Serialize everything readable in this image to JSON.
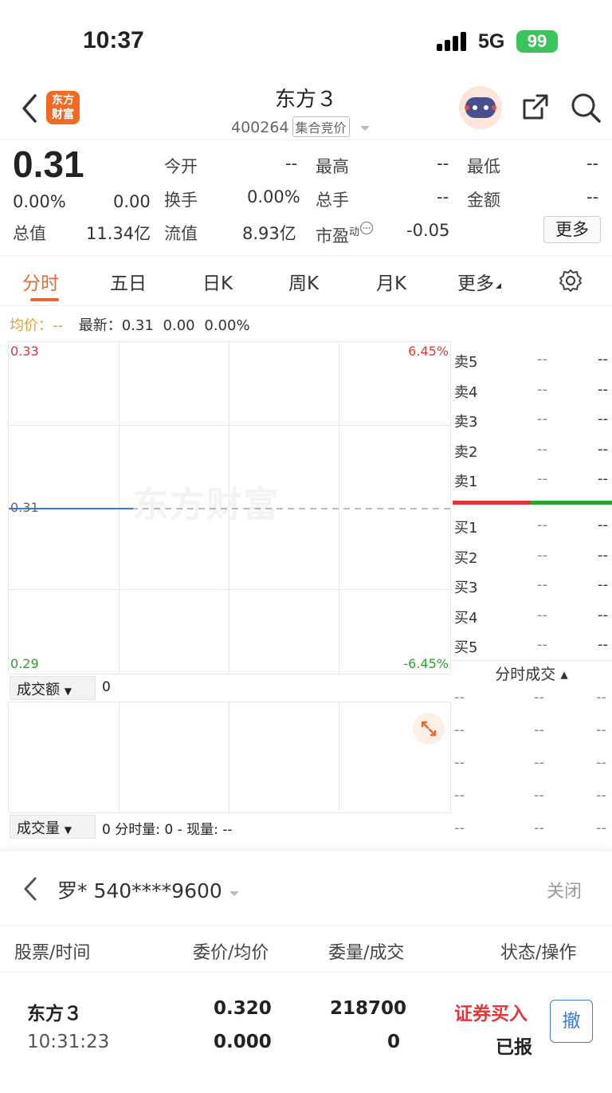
{
  "status_bar": {
    "time": "10:37",
    "network": "5G",
    "battery": "99"
  },
  "header": {
    "logo_line1": "东方",
    "logo_line2": "财富",
    "title": "东方３",
    "code": "400264",
    "tag": "集合竞价"
  },
  "quote": {
    "price": "0.31",
    "change_pct": "0.00%",
    "change": "0.00",
    "fields": [
      {
        "label": "今开",
        "value": "--"
      },
      {
        "label": "最高",
        "value": "--"
      },
      {
        "label": "最低",
        "value": "--"
      },
      {
        "label": "换手",
        "value": "0.00%"
      },
      {
        "label": "总手",
        "value": "--"
      },
      {
        "label": "金额",
        "value": "--"
      },
      {
        "label": "总值",
        "value": "11.34亿"
      },
      {
        "label": "流值",
        "value": "8.93亿"
      },
      {
        "label": "市盈",
        "sup": "动",
        "value": "-0.05"
      }
    ],
    "more_label": "更多"
  },
  "tabs": [
    "分时",
    "五日",
    "日K",
    "周K",
    "月K",
    "更多"
  ],
  "chart_info": {
    "avg_label": "均价：--",
    "latest_label": "最新：",
    "latest": "0.31",
    "change": "0.00",
    "change_pct": "0.00%"
  },
  "chart_data": {
    "type": "line",
    "y_high": "0.33",
    "y_mid": "0.31",
    "y_low": "0.29",
    "pct_high": "6.45%",
    "pct_low": "-6.45%",
    "watermark": "东方财富",
    "ylim": [
      0.29,
      0.33
    ],
    "last_price": 0.31
  },
  "order_book": {
    "asks": [
      {
        "level": "卖5",
        "price": "--",
        "vol": "--"
      },
      {
        "level": "卖4",
        "price": "--",
        "vol": "--"
      },
      {
        "level": "卖3",
        "price": "--",
        "vol": "--"
      },
      {
        "level": "卖2",
        "price": "--",
        "vol": "--"
      },
      {
        "level": "卖1",
        "price": "--",
        "vol": "--"
      }
    ],
    "bids": [
      {
        "level": "买1",
        "price": "--",
        "vol": "--"
      },
      {
        "level": "买2",
        "price": "--",
        "vol": "--"
      },
      {
        "level": "买3",
        "price": "--",
        "vol": "--"
      },
      {
        "level": "买4",
        "price": "--",
        "vol": "--"
      },
      {
        "level": "买5",
        "price": "--",
        "vol": "--"
      }
    ]
  },
  "ticks": {
    "title": "分时成交 ▴",
    "rows": [
      [
        "--",
        "--",
        "--"
      ],
      [
        "--",
        "--",
        "--"
      ],
      [
        "--",
        "--",
        "--"
      ],
      [
        "--",
        "--",
        "--"
      ],
      [
        "--",
        "--",
        "--"
      ]
    ]
  },
  "volume": {
    "amount_label": "成交额",
    "amount_value": "0",
    "volume_label": "成交量",
    "volume_value": "0 分时量: 0 - 现量: --"
  },
  "panel": {
    "account": "罗* 540****9600",
    "close": "关闭",
    "headers": [
      "股票/时间",
      "委价/均价",
      "委量/成交",
      "状态/操作"
    ],
    "order": {
      "name": "东方３",
      "time": "10:31:23",
      "price": "0.320",
      "avg_price": "0.000",
      "qty": "218700",
      "filled": "0",
      "type": "证券买入",
      "status": "已报",
      "cancel": "撤"
    }
  },
  "colors": {
    "accent": "#e9692c",
    "up": "#e0383a",
    "down": "#2ea22e",
    "link": "#3a7bd5"
  }
}
